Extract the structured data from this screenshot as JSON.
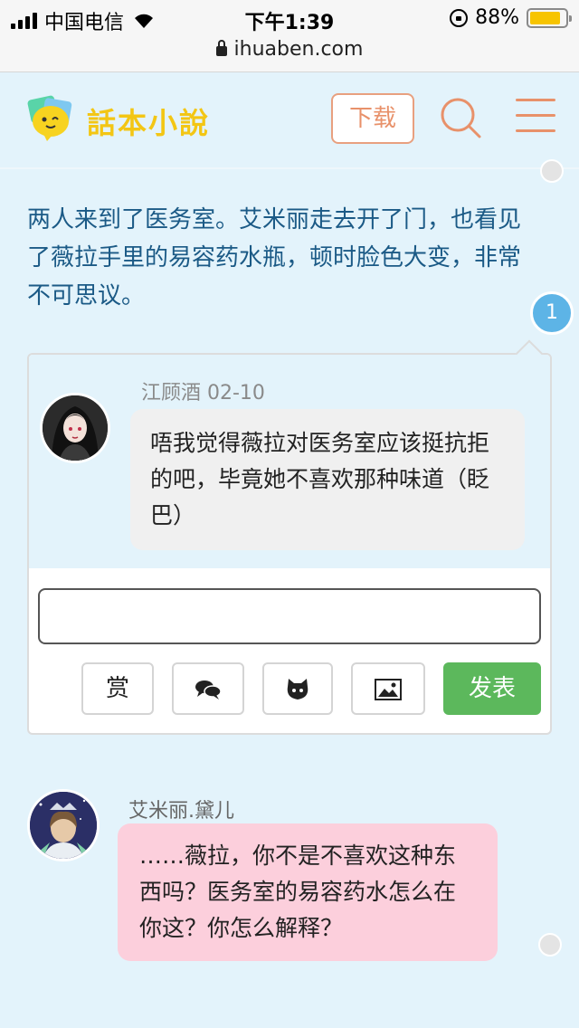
{
  "status_bar": {
    "carrier": "中国电信",
    "time": "下午1:39",
    "battery": "88%",
    "battery_level": 0.88
  },
  "url_bar": {
    "url": "ihuaben.com"
  },
  "header": {
    "logo_text": "話本小說",
    "download_label": "下载"
  },
  "story": {
    "narration": "两人来到了医务室。艾米丽走去开了门，也看见了薇拉手里的易容药水瓶，顿时脸色大变，非常不可思议。",
    "comment_count": "1"
  },
  "comment": {
    "author_date": "江顾酒 02-10",
    "text": "唔我觉得薇拉对医务室应该挺抗拒的吧，毕竟她不喜欢那种味道（眨巴）"
  },
  "reply_toolbar": {
    "reward_label": "赏",
    "send_label": "发表"
  },
  "dialogue": {
    "speaker": "艾米丽.黛儿",
    "text": "……薇拉，你不是不喜欢这种东西吗？医务室的易容药水怎么在你这？你怎么解释？"
  },
  "colors": {
    "page_bg": "#e3f3fb",
    "narration_text": "#1b5a86",
    "accent_orange": "#e8916a",
    "send_green": "#5cb85c",
    "dialogue_bubble": "#fccfdc",
    "badge_blue": "#5db4e6"
  }
}
